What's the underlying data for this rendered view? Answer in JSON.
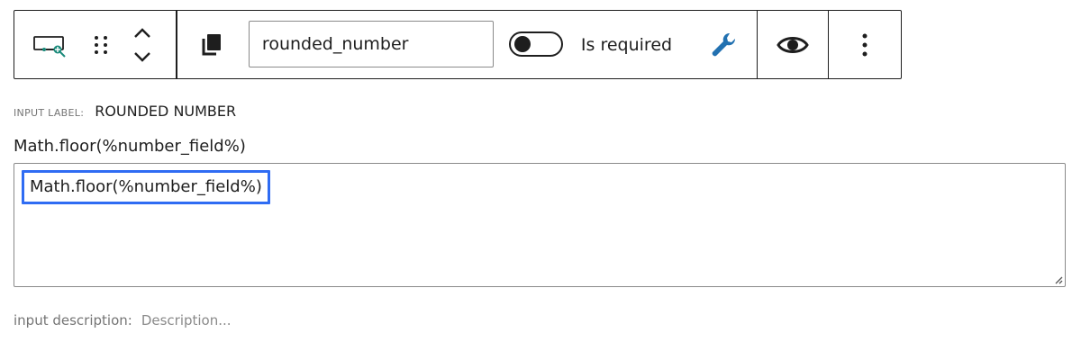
{
  "toolbar": {
    "block_icon": "calculated-field-icon",
    "drag_icon": "drag-handle-icon",
    "move_up_icon": "chevron-up-icon",
    "move_down_icon": "chevron-down-icon",
    "copy_icon": "copy-icon",
    "field_name_value": "rounded_number",
    "required_toggle": {
      "label": "Is required",
      "checked": false
    },
    "settings_icon": "wrench-icon",
    "preview_icon": "eye-icon",
    "more_icon": "more-vertical-icon"
  },
  "input_label": {
    "caption": "INPUT LABEL:",
    "value": "ROUNDED NUMBER"
  },
  "formula": {
    "label": "Math.floor(%number_field%)",
    "value": "Math.floor(%number_field%)"
  },
  "description": {
    "caption": "input description:",
    "placeholder": "Description..."
  },
  "colors": {
    "accent_blue": "#2f6cf3",
    "icon_teal": "#1a8a7a",
    "wrench_blue": "#2271b1",
    "border_dark": "#1e1e1e"
  }
}
